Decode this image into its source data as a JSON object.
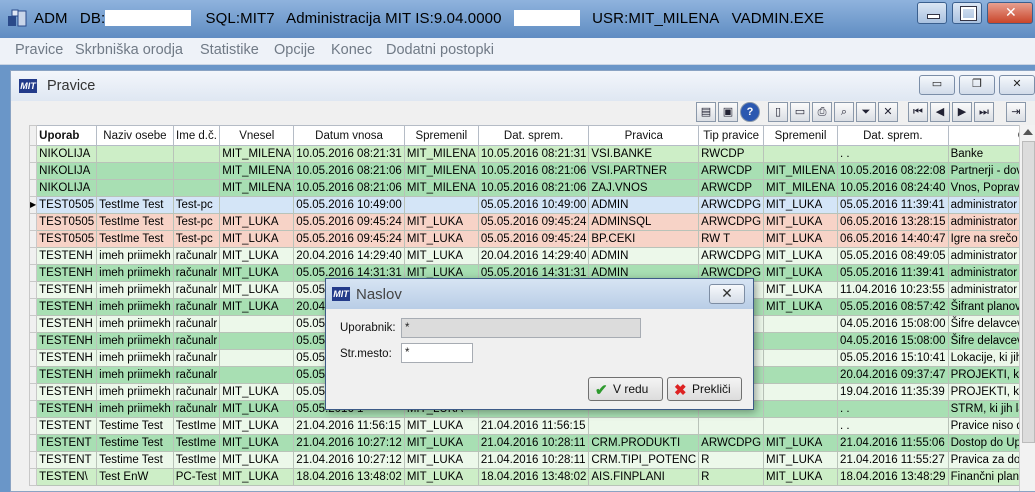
{
  "window": {
    "title_parts": [
      "ADM",
      "DB:",
      "SQL:MIT7",
      "Administracija MIT IS:9.04.0000",
      "USR:MIT_MILENA",
      "VADMIN.EXE"
    ],
    "minimize_glyph": "▬",
    "maximize_glyph": "□",
    "close_glyph": "✕"
  },
  "menu": [
    "Pravice",
    "Skrbniška orodja",
    "Statistike",
    "Opcije",
    "Konec",
    "Dodatni postopki"
  ],
  "child": {
    "title": "Pravice",
    "logo_text": "MIT",
    "minimize_glyph": "▭",
    "restore_glyph": "❐",
    "close_glyph": "✕"
  },
  "toolbar": {
    "icons": [
      "report-icon",
      "screen-icon",
      "help-icon",
      "new-icon",
      "open-icon",
      "print-icon",
      "zoom-icon",
      "filter-icon",
      "clear-filter-icon",
      "first-icon",
      "prev-icon",
      "next-icon",
      "last-icon",
      "exit-icon"
    ],
    "glyphs": [
      "▤",
      "▣",
      "?",
      "▯",
      "▭",
      "⎙",
      "⌕",
      "⏷",
      "✕",
      "⏮",
      "◀",
      "▶",
      "⏭",
      "⇥"
    ]
  },
  "grid": {
    "columns": [
      "Uporab",
      "Naziv osebe",
      "Ime d.č.",
      "Vnesel",
      "Datum vnosa",
      "Spremenil",
      "Dat. sprem.",
      "Pravica",
      "Tip pravice",
      "Spremenil",
      "Dat. sprem.",
      "Opis"
    ],
    "rows": [
      {
        "style": "green",
        "cells": [
          "NIKOLIJA",
          "",
          "",
          "MIT_MILENA",
          "10.05.2016 08:21:31",
          "MIT_MILENA",
          "10.05.2016 08:21:31",
          "VSI.BANKE",
          "RWCDP",
          "",
          ". .",
          "Banke"
        ]
      },
      {
        "style": "dark",
        "cells": [
          "NIKOLIJA",
          "",
          "",
          "MIT_MILENA",
          "10.05.2016 08:21:06",
          "MIT_MILENA",
          "10.05.2016 08:21:06",
          "VSI.PARTNER",
          "ARWCDP",
          "MIT_MILENA",
          "10.05.2016 08:22:08",
          "Partnerji - dovoljenja za delo"
        ]
      },
      {
        "style": "dark",
        "cells": [
          "NIKOLIJA",
          "",
          "",
          "MIT_MILENA",
          "10.05.2016 08:21:06",
          "MIT_MILENA",
          "10.05.2016 08:21:06",
          "ZAJ.VNOS",
          "ARWCDP",
          "MIT_MILENA",
          "10.05.2016 08:24:40",
          "Vnos, Popravljanje in za Podp"
        ]
      },
      {
        "style": "sel",
        "cells": [
          "TEST0505",
          "TestIme Test",
          "Test-pc",
          "",
          "05.05.2016 10:49:00",
          "",
          "05.05.2016 10:49:00",
          "ADMIN",
          "ARWCDPG",
          "MIT_LUKA",
          "05.05.2016 11:39:41",
          "administrator - ima vse pravice"
        ]
      },
      {
        "style": "salmon",
        "cells": [
          "TEST0505",
          "TestIme Test",
          "Test-pc",
          "MIT_LUKA",
          "05.05.2016 09:45:24",
          "MIT_LUKA",
          "05.05.2016 09:45:24",
          "ADMINSQL",
          "ARWCDPG",
          "MIT_LUKA",
          "06.05.2016 13:28:15",
          "administrator ima vse pravice"
        ]
      },
      {
        "style": "salmon",
        "cells": [
          "TEST0505",
          "TestIme Test",
          "Test-pc",
          "MIT_LUKA",
          "05.05.2016 09:45:24",
          "MIT_LUKA",
          "05.05.2016 09:45:24",
          "BP.CEKI",
          "RW    T",
          "MIT_LUKA",
          "06.05.2016 14:40:47",
          "Igre na srečo - seznam dovolje"
        ]
      },
      {
        "style": "light",
        "cells": [
          "TESTENH",
          "imeh priimekh",
          "računalr",
          "MIT_LUKA",
          "20.04.2016 14:29:40",
          "MIT_LUKA",
          "20.04.2016 14:29:40",
          "ADMIN",
          "ARWCDPG",
          "MIT_LUKA",
          "05.05.2016 08:49:05",
          "administrator - ima vse pravice"
        ]
      },
      {
        "style": "dark",
        "cells": [
          "TESTENH",
          "imeh priimekh",
          "računalr",
          "MIT_LUKA",
          "05.05.2016 14:31:31",
          "MIT_LUKA",
          "05.05.2016 14:31:31",
          "ADMIN",
          "ARWCDPG",
          "MIT_LUKA",
          "05.05.2016 11:39:41",
          "administrator - ima vse pravice"
        ]
      },
      {
        "style": "light",
        "cells": [
          "TESTENH",
          "imeh priimekh",
          "računalr",
          "MIT_LUKA",
          "05.05.2016 1",
          "",
          "",
          "",
          "",
          "MIT_LUKA",
          "11.04.2016 10:23:55",
          "administrator - ima vse pravice"
        ]
      },
      {
        "style": "dark",
        "cells": [
          "TESTENH",
          "imeh priimekh",
          "računalr",
          "MIT_LUKA",
          "20.04.2016 1",
          "",
          "",
          "",
          "",
          "MIT_LUKA",
          "05.05.2016 08:57:42",
          "Šifrant planov,dodajanje novih"
        ]
      },
      {
        "style": "light",
        "cells": [
          "TESTENH",
          "imeh priimekh",
          "računalr",
          "",
          "05.05.2016 1",
          "",
          "",
          "",
          "",
          "",
          "04.05.2016 15:08:00",
          "Šifre delavcev do katerih ima"
        ]
      },
      {
        "style": "dark",
        "cells": [
          "TESTENH",
          "imeh priimekh",
          "računalr",
          "",
          "05.05.2016 1",
          "",
          "",
          "",
          "",
          "",
          "04.05.2016 15:08:00",
          "Šifre delavcev do katerih ima"
        ]
      },
      {
        "style": "light",
        "cells": [
          "TESTENH",
          "imeh priimekh",
          "računalr",
          "",
          "05.05.2016 1",
          "",
          "",
          "",
          "",
          "",
          "05.05.2016 15:10:41",
          "Lokacije, ki jih lahko uporabni"
        ]
      },
      {
        "style": "dark",
        "cells": [
          "TESTENH",
          "imeh priimekh",
          "računalr",
          "",
          "05.05.2016 1",
          "",
          "",
          "",
          "",
          "",
          "20.04.2016 09:37:47",
          "PROJEKTI, ki jih lahko uporabl"
        ]
      },
      {
        "style": "light",
        "cells": [
          "TESTENH",
          "imeh priimekh",
          "računalr",
          "MIT_LUKA",
          "05.05.2016 1",
          "",
          "",
          "",
          "",
          "",
          "19.04.2016 11:35:39",
          "PROJEKTI, ki jih lahko uporabl"
        ]
      },
      {
        "style": "dark",
        "cells": [
          "TESTENH",
          "imeh priimekh",
          "računalr",
          "MIT_LUKA",
          "05.05.2016 1",
          "MIT_LUKA",
          "",
          "",
          "",
          "",
          ". .",
          "STRM, ki jih lahko uporabnik"
        ]
      },
      {
        "style": "light",
        "cells": [
          "TESTENT",
          "Testime Test",
          "TestIme",
          "MIT_LUKA",
          "21.04.2016 11:56:15",
          "MIT_LUKA",
          "21.04.2016 11:56:15",
          "",
          "",
          "",
          ". .",
          "Pravice niso dodeljene"
        ]
      },
      {
        "style": "dark",
        "cells": [
          "TESTENT",
          "Testime Test",
          "TestIme",
          "MIT_LUKA",
          "21.04.2016 10:27:12",
          "MIT_LUKA",
          "21.04.2016 10:28:11",
          "CRM.PRODUKTI",
          "ARWCDPG",
          "MIT_LUKA",
          "21.04.2016 11:55:06",
          "Dostop do Upravljanja s produ"
        ]
      },
      {
        "style": "light",
        "cells": [
          "TESTENT",
          "Testime Test",
          "TestIme",
          "MIT_LUKA",
          "21.04.2016 10:27:12",
          "MIT_LUKA",
          "21.04.2016 10:28:11",
          "CRM.TIPI_POTENC",
          "R",
          "MIT_LUKA",
          "21.04.2016 11:55:27",
          "Pravica za dostop do potencia"
        ]
      },
      {
        "style": "green",
        "cells": [
          "TESTEN\\",
          "Test EnW",
          "PC-Test",
          "MIT_LUKA",
          "18.04.2016 13:48:02",
          "MIT_LUKA",
          "18.04.2016 13:48:02",
          "AIS.FINPLANI",
          "R",
          "MIT_LUKA",
          "18.04.2016 13:48:29",
          "Finančni plani"
        ]
      }
    ]
  },
  "dialog": {
    "title": "Naslov",
    "logo_text": "MIT",
    "close_glyph": "✕",
    "user_label": "Uporabnik:",
    "user_value": "*",
    "place_label": "Str.mesto:",
    "place_value": "*",
    "ok_label": "V redu",
    "ok_glyph": "✔",
    "cancel_label": "Prekliči",
    "cancel_glyph": "✖"
  }
}
